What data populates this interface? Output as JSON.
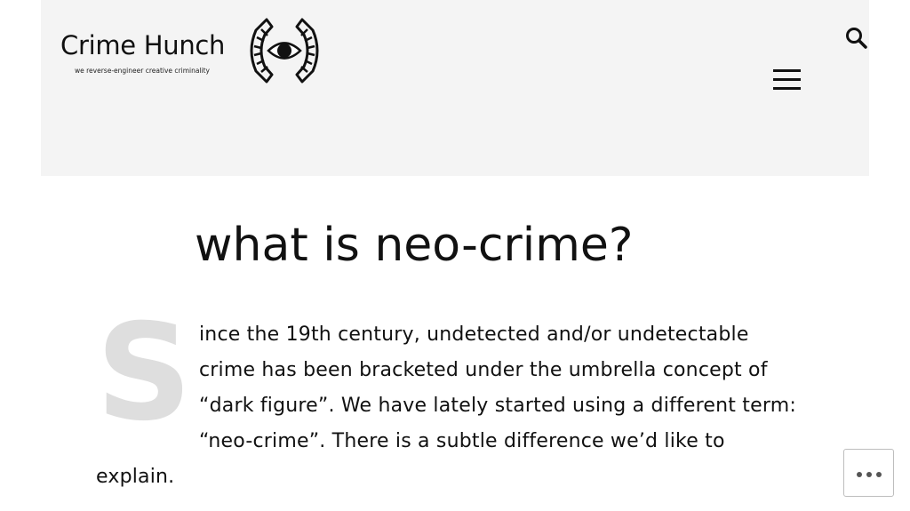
{
  "site": {
    "name": "Crime Hunch",
    "tagline": "we reverse-engineer creative criminality",
    "logo_icon": "eye-in-brackets-icon"
  },
  "header": {
    "search_icon": "search-icon",
    "menu_icon": "hamburger-menu-icon"
  },
  "article": {
    "title": "what is neo-crime?",
    "dropcap": "S",
    "lines": [
      "ince the 19th century, undetected and/or undetectable",
      "crime has been bracketed under the umbrella concept of",
      "“dark figure”. We have lately started using a different term:",
      "“neo-crime”. There is a subtle difference we’d like to",
      "explain."
    ]
  },
  "actions": {
    "more_icon": "ellipsis-icon"
  },
  "colors": {
    "header_bg": "#f4f4f4",
    "dropcap": "#dedede",
    "text": "#111111"
  }
}
